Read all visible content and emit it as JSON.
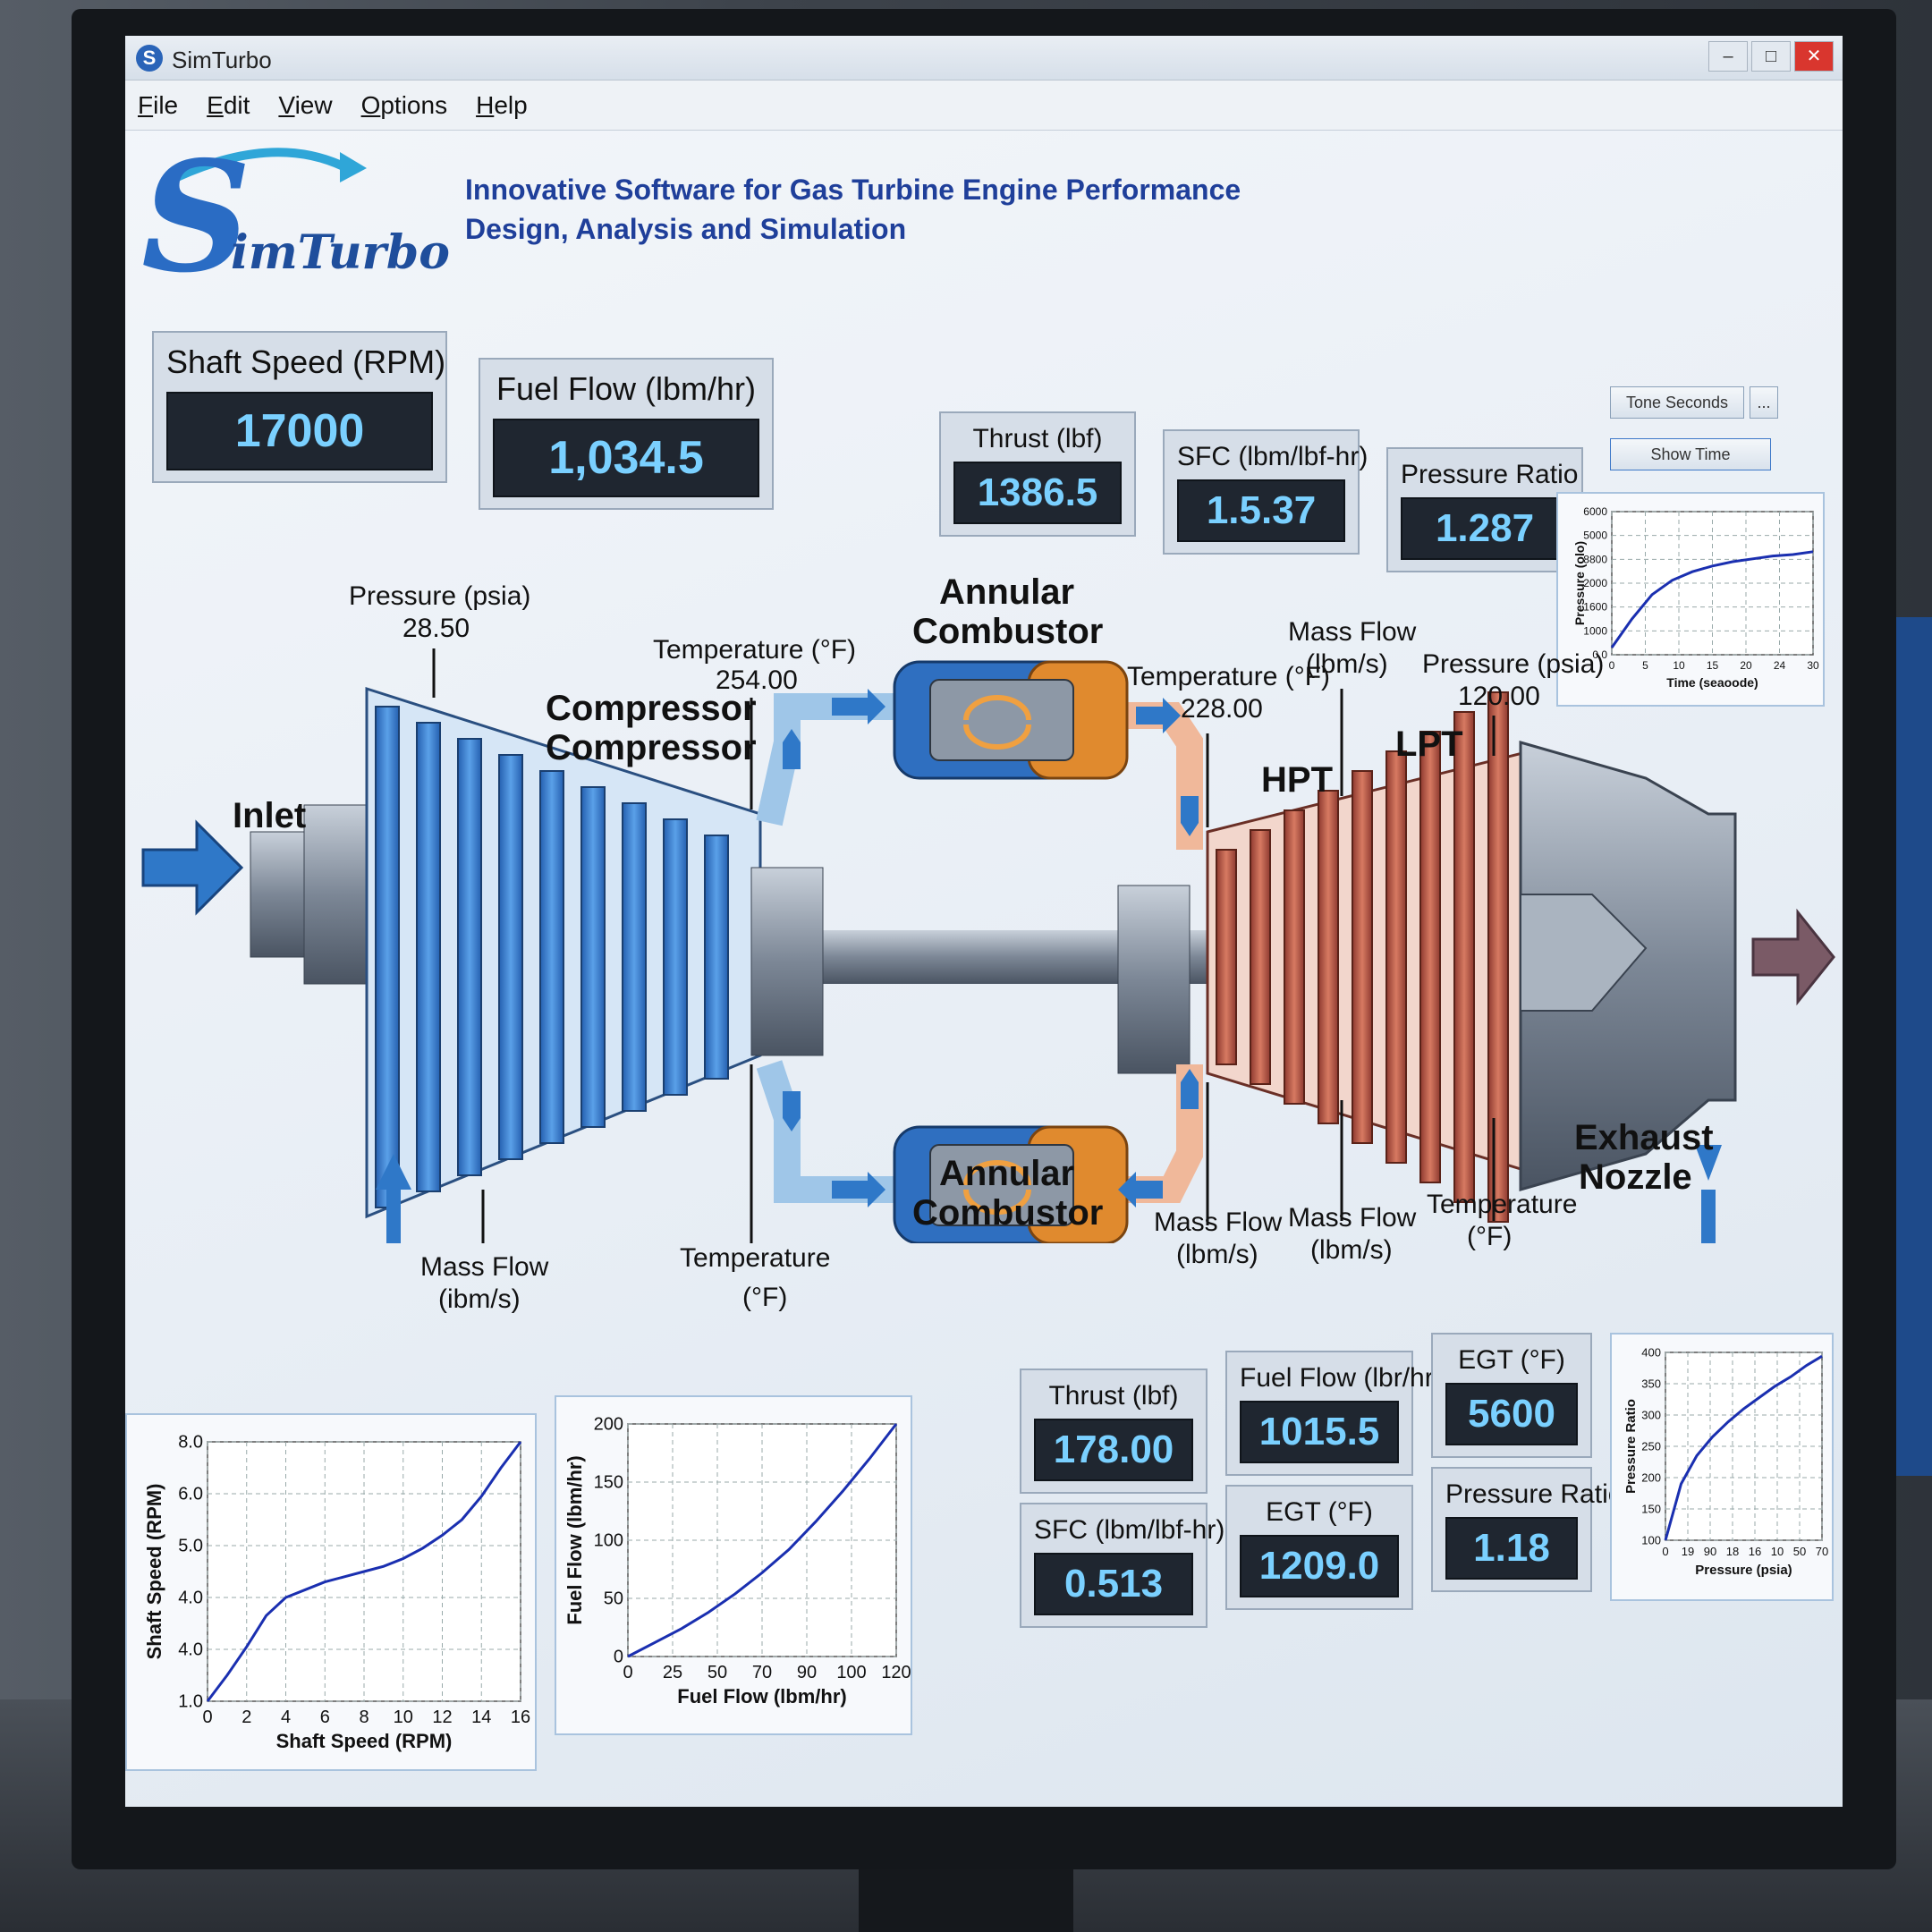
{
  "window": {
    "title": "SimTurbo",
    "app_icon": "S",
    "minimize": "‒",
    "maximize": "□",
    "close": "✕"
  },
  "menu": [
    "File",
    "Edit",
    "View",
    "Options",
    "Help"
  ],
  "brand": {
    "logo_letter": "S",
    "logo_text": "imTurbo",
    "tagline_1": "Innovative Software for Gas Turbine Engine Performance",
    "tagline_2": "Design, Analysis and Simulation"
  },
  "top_readouts": {
    "shaft_speed": {
      "label": "Shaft Speed (RPM)",
      "value": "17000"
    },
    "fuel_flow": {
      "label": "Fuel Flow (lbm/hr)",
      "value": "1,034.5"
    },
    "thrust": {
      "label": "Thrust (lbf)",
      "value": "1386.5"
    },
    "sfc": {
      "label": "SFC (lbm/lbf-hr)",
      "value": "1.5.37"
    },
    "pressure_ratio": {
      "label": "Pressure Ratio",
      "value": "1.287"
    }
  },
  "controls": {
    "tone_seconds": "Tone Seconds",
    "show_time": "Show Time",
    "more": "..."
  },
  "diagram": {
    "inlet": "Inlet",
    "compressor_1": "Compressor",
    "compressor_2": "Compressor",
    "combustor_top_1": "Annular",
    "combustor_top_2": "Combustor",
    "combustor_bottom_1": "Annular",
    "combustor_bottom_2": "Combustor",
    "hpt": "HPT",
    "lpt": "LPT",
    "exhaust_1": "Exhaust",
    "exhaust_2": "Nozzle",
    "inlet_pressure_label": "Pressure (psia)",
    "inlet_pressure_value": "28.50",
    "comp_exit_temp_label": "Temperature (°F)",
    "comp_exit_temp_value": "254.00",
    "turb_temp_label": "Temperature (°F)",
    "turb_temp_value": "228.00",
    "turb_mass_flow_1": "Mass Flow",
    "turb_mass_flow_2": "(lbm/s)",
    "turb_pressure_label": "Pressure (psia)",
    "turb_pressure_value": "120.00",
    "comp_mass_flow_1": "Mass Flow",
    "comp_mass_flow_2": "(ibm/s)",
    "comp_temp_1": "Temperature",
    "comp_temp_2": "(°F)",
    "hpt_mass_flow_1": "Mass Flow",
    "hpt_mass_flow_2": "(lbm/s)",
    "lpt_mass_flow_1": "Mass Flow",
    "lpt_mass_flow_2": "(lbm/s)",
    "nozzle_temp_1": "Temperature",
    "nozzle_temp_2": "(°F)"
  },
  "bottom_readouts": {
    "thrust": {
      "label": "Thrust (lbf)",
      "value": "178.00"
    },
    "fuel_flow": {
      "label": "Fuel Flow (lbr/hr)",
      "value": "1015.5"
    },
    "egt_1": {
      "label": "EGT (°F)",
      "value": "5600"
    },
    "sfc": {
      "label": "SFC (lbm/lbf-hr)",
      "value": "0.513"
    },
    "egt_2": {
      "label": "EGT (°F)",
      "value": "1209.0"
    },
    "pressure_ratio": {
      "label": "Pressure Ratio",
      "value": "1.18"
    }
  },
  "colors": {
    "compressor": "#2f78c8",
    "turbine": "#b25a4a",
    "combustor_cold": "#2f6fc0",
    "combustor_hot": "#e08a2e",
    "readout_bg": "#1f2630",
    "readout_text": "#7ad0ff",
    "curve": "#1a2fb0"
  },
  "chart_data": [
    {
      "type": "line",
      "xlabel": "Time (seaoode)",
      "ylabel": "Pressure (olo)",
      "x_ticks": [
        "0",
        "5",
        "10",
        "15",
        "20",
        "24",
        "30"
      ],
      "y_ticks": [
        "0.0",
        "1000",
        "1600",
        "2000",
        "8800",
        "5000",
        "6000"
      ],
      "x": [
        0,
        3,
        6,
        9,
        12,
        15,
        18,
        21,
        24,
        27,
        30
      ],
      "y": [
        0.05,
        0.25,
        0.42,
        0.52,
        0.58,
        0.62,
        0.65,
        0.67,
        0.69,
        0.7,
        0.72
      ]
    },
    {
      "type": "line",
      "xlabel": "Shaft Speed (RPM)",
      "ylabel": "Shaft Speed (RPM)",
      "x_ticks": [
        "0",
        "2",
        "4",
        "6",
        "8",
        "10",
        "12",
        "14",
        "16"
      ],
      "y_ticks": [
        "1.0",
        "4.0",
        "4.0",
        "5.0",
        "6.0",
        "8.0"
      ],
      "x": [
        0,
        1,
        2,
        3,
        4,
        5,
        6,
        7,
        8,
        9,
        10,
        11,
        12,
        13,
        14,
        15,
        16
      ],
      "y": [
        0.0,
        0.1,
        0.21,
        0.33,
        0.4,
        0.43,
        0.46,
        0.48,
        0.5,
        0.52,
        0.55,
        0.59,
        0.64,
        0.7,
        0.79,
        0.9,
        1.0
      ]
    },
    {
      "type": "line",
      "xlabel": "Fuel Flow (lbm/hr)",
      "ylabel": "Fuel Flow (lbm/hr)",
      "x_ticks": [
        "0",
        "25",
        "50",
        "70",
        "90",
        "100",
        "120"
      ],
      "y_ticks": [
        "0",
        "50",
        "100",
        "150",
        "200"
      ],
      "x": [
        0,
        12,
        24,
        36,
        48,
        60,
        72,
        84,
        96,
        108,
        120
      ],
      "y": [
        0,
        0.06,
        0.12,
        0.19,
        0.27,
        0.36,
        0.46,
        0.58,
        0.71,
        0.85,
        1.0
      ]
    },
    {
      "type": "line",
      "xlabel": "Pressure (psia)",
      "ylabel": "Pressure Ratio",
      "x_ticks": [
        "0",
        "19",
        "90",
        "18",
        "16",
        "10",
        "50",
        "70"
      ],
      "y_ticks": [
        "100",
        "150",
        "200",
        "250",
        "300",
        "350",
        "400"
      ],
      "x": [
        0,
        1,
        2,
        3,
        4,
        5,
        6,
        7,
        8,
        9,
        10
      ],
      "y": [
        0.0,
        0.3,
        0.45,
        0.55,
        0.63,
        0.7,
        0.76,
        0.82,
        0.87,
        0.93,
        0.98
      ]
    }
  ]
}
